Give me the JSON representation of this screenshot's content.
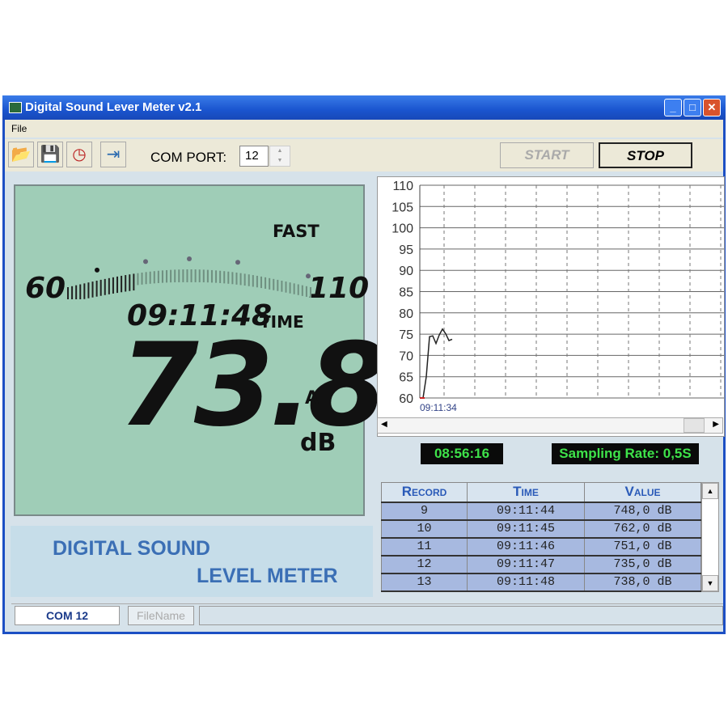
{
  "window": {
    "title": "Digital Sound Lever Meter v2.1",
    "menu": [
      "File"
    ]
  },
  "toolbar": {
    "icons": [
      "open-folder-icon",
      "save-icon",
      "clock-icon",
      "exit-icon"
    ],
    "com_port_label": "COM PORT:",
    "com_port_value": "12",
    "start_label": "START",
    "stop_label": "STOP"
  },
  "lcd": {
    "response": "FAST",
    "scale_min": "60",
    "scale_max": "110",
    "time": "09:11:48",
    "time_label": "TIME",
    "reading": "73.8",
    "weighting": "A",
    "unit": "dB",
    "bar_level_db": 73.8
  },
  "logo": {
    "line1": "DIGITAL SOUND",
    "line2": "LEVEL METER"
  },
  "chart_data": {
    "type": "line",
    "ylim": [
      60,
      110
    ],
    "yticks": [
      "110",
      "105",
      "100",
      "95",
      "90",
      "85",
      "80",
      "75",
      "70",
      "65",
      "60"
    ],
    "x_start_label": "09:11:34",
    "grid": true,
    "values": [
      60,
      60,
      65,
      74.4,
      74.6,
      72.8,
      74.8,
      76.2,
      75.1,
      73.5,
      73.8
    ],
    "line_color": "#222222",
    "baseline_color": "#cc2222"
  },
  "clock": "08:56:16",
  "sampling": "Sampling Rate: 0,5S",
  "table": {
    "headers": [
      "Record",
      "Time",
      "Value"
    ],
    "rows": [
      [
        "9",
        "09:11:44",
        "748,0 dB"
      ],
      [
        "10",
        "09:11:45",
        "762,0 dB"
      ],
      [
        "11",
        "09:11:46",
        "751,0 dB"
      ],
      [
        "12",
        "09:11:47",
        "735,0 dB"
      ],
      [
        "13",
        "09:11:48",
        "738,0 dB"
      ]
    ]
  },
  "status": {
    "port": "COM 12",
    "filename": "FileName"
  }
}
